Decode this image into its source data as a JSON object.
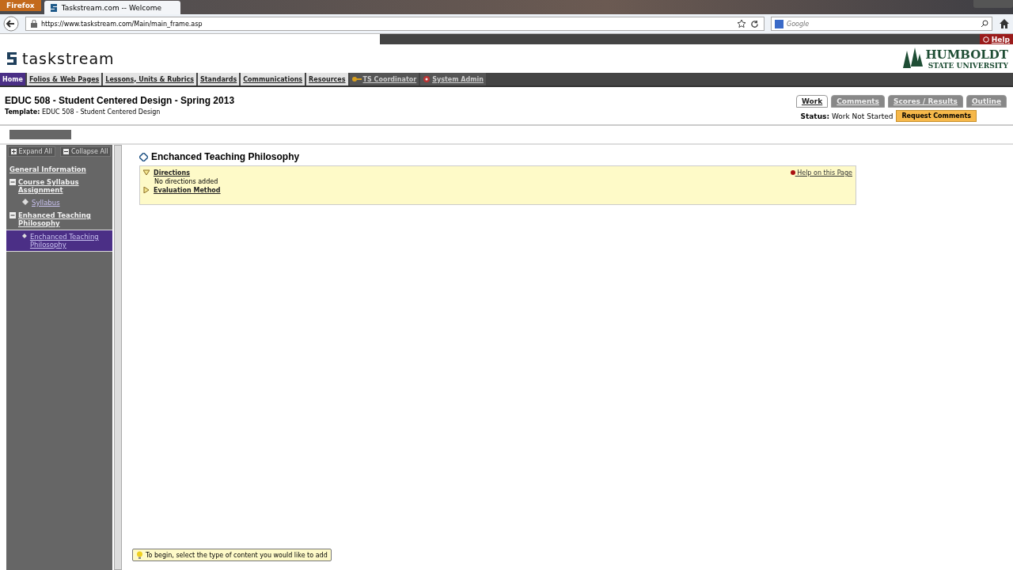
{
  "browser": {
    "menu_button": "Firefox",
    "tab_title": "Taskstream.com -- Welcome",
    "url": "https://www.taskstream.com/Main/main_frame.asp",
    "search": {
      "placeholder": "Google"
    }
  },
  "header": {
    "logo": "taskstream",
    "help": "Help",
    "university": {
      "name": "HUMBOLDT",
      "subtitle": "STATE UNIVERSITY"
    }
  },
  "nav": [
    {
      "label": "Home",
      "selected": true,
      "kind": "plain"
    },
    {
      "label": "Folios & Web Pages",
      "selected": false,
      "kind": "plain"
    },
    {
      "label": "Lessons, Units & Rubrics",
      "selected": false,
      "kind": "plain"
    },
    {
      "label": "Standards",
      "selected": false,
      "kind": "plain"
    },
    {
      "label": "Communications",
      "selected": false,
      "kind": "plain"
    },
    {
      "label": "Resources",
      "selected": false,
      "kind": "plain"
    },
    {
      "label": "TS Coordinator",
      "selected": false,
      "kind": "key"
    },
    {
      "label": "System Admin",
      "selected": false,
      "kind": "gear"
    }
  ],
  "page": {
    "title": "EDUC 508 - Student Centered Design - Spring 2013",
    "template_label": "Template:",
    "template": "EDUC 508 - Student Centered Design"
  },
  "tabs": [
    {
      "label": "Work",
      "selected": true
    },
    {
      "label": "Comments",
      "selected": false
    },
    {
      "label": "Scores / Results",
      "selected": false
    },
    {
      "label": "Outline",
      "selected": false
    }
  ],
  "status": {
    "label": "Status:",
    "value": "Work Not Started",
    "button": "Request Comments"
  },
  "sidebar": {
    "expand": "Expand All",
    "collapse": "Collapse All",
    "items": [
      {
        "label": "General Information",
        "selected": false
      },
      {
        "label": "Course Syllabus Assignment",
        "expanded": true,
        "selected": false,
        "children": [
          {
            "label": "Syllabus",
            "selected": false
          }
        ]
      },
      {
        "label": "Enhanced Teaching Philosophy",
        "expanded": true,
        "selected": false,
        "children": [
          {
            "label": "Enchanced Teaching Philosophy",
            "selected": true
          }
        ]
      }
    ]
  },
  "content": {
    "title": "Enchanced Teaching Philosophy",
    "help": "Help on this Page",
    "sections": [
      {
        "label": "Directions",
        "expanded": true,
        "body": "No directions added"
      },
      {
        "label": "Evaluation Method",
        "expanded": false
      }
    ]
  },
  "tooltip": "To begin, select the type of content you would like to add"
}
